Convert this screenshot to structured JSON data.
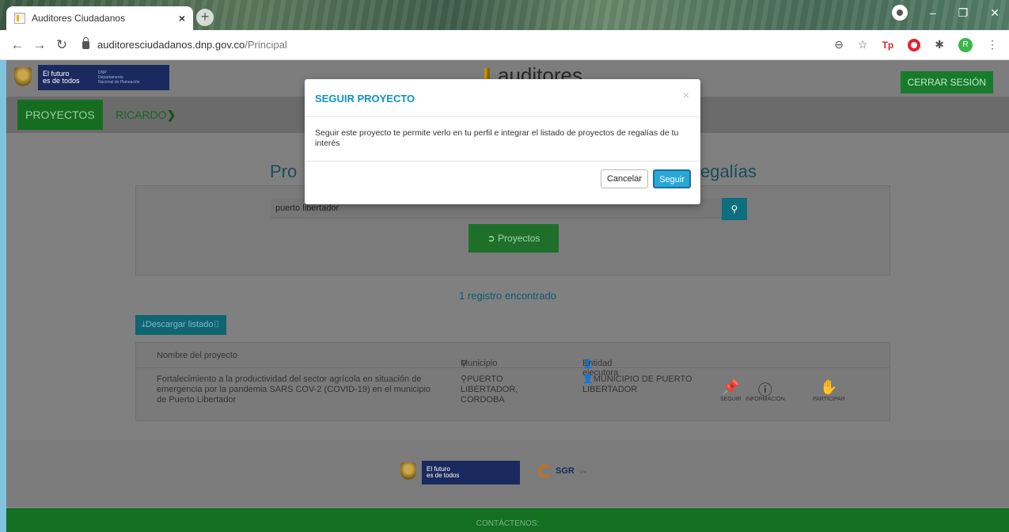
{
  "browser": {
    "tab_title": "Auditores Ciudadanos",
    "url_host": "auditoresciudadanos.dnp.gov.co",
    "url_path": "/Principal"
  },
  "header": {
    "gov_logo_line1": "El futuro",
    "gov_logo_line2": "es de todos",
    "gov_logo_sub1": "DNP",
    "gov_logo_sub2": "Departamento",
    "gov_logo_sub3": "Nacional de Planeación",
    "brand": "auditores",
    "logout": "CERRAR SESIÓN"
  },
  "nav": {
    "projects": "PROYECTOS",
    "user": "RICARDO"
  },
  "main": {
    "heading_left": "Pro",
    "heading_right": "egalías",
    "search_value": "puerto libertador",
    "projects_button": "Proyectos",
    "result_count": "1 registro encontrado",
    "download_label": "Descargar listado"
  },
  "table": {
    "headers": {
      "name": "Nombre del proyecto",
      "municipio": "Municipio",
      "entidad": "Entidad ejecutora"
    },
    "rows": [
      {
        "name": "Fortalecimiento a la productividad del sector agrícola en situación de emergencia por la pandemia SARS COV-2 (COVID-19) en el municipio de Puerto Libertador",
        "municipio": "PUERTO LIBERTADOR, CORDOBA",
        "entidad": "MUNICIPIO DE PUERTO LIBERTADOR",
        "actions": {
          "follow": "SEGUIR",
          "info": "INFORMACIÓN",
          "participate": "PARTICIPAR"
        }
      }
    ]
  },
  "footer": {
    "logo_line1": "El futuro",
    "logo_line2": "es de todos",
    "sgr": "SGR",
    "contact": "CONTÁCTENOS:"
  },
  "modal": {
    "title": "SEGUIR PROYECTO",
    "close": "×",
    "body": "Seguir este proyecto te permite verlo en tu perfil e integrar el listado de proyectos de regalías de tu interés",
    "cancel": "Cancelar",
    "follow": "Seguir"
  },
  "colors": {
    "modal_title": "#1192c8",
    "primary_button": "#29a8d8",
    "green": "#187b2b"
  }
}
